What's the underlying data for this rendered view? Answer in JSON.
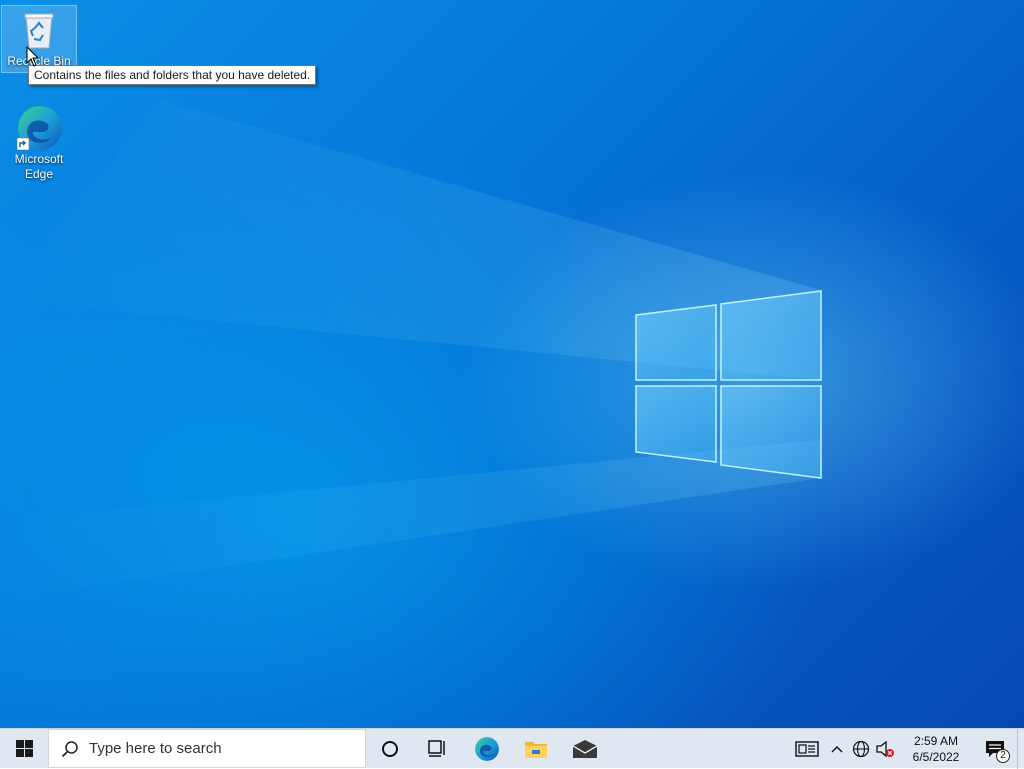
{
  "desktop": {
    "icons": [
      {
        "label": "Recycle Bin",
        "icon": "recycle-bin-icon",
        "selected": true
      },
      {
        "label": "Microsoft Edge",
        "label_lines": [
          "Microsoft",
          "Edge"
        ],
        "icon": "edge-icon",
        "shortcut": true
      }
    ],
    "tooltip": "Contains the files and folders that you have deleted."
  },
  "taskbar": {
    "start_icon": "windows-logo-icon",
    "search": {
      "placeholder": "Type here to search",
      "icon": "search-icon"
    },
    "cortana_icon": "cortana-circle-icon",
    "task_view_icon": "task-view-icon",
    "pinned_apps": [
      {
        "name": "Microsoft Edge",
        "icon": "edge-icon"
      },
      {
        "name": "File Explorer",
        "icon": "file-explorer-icon"
      },
      {
        "name": "Mail",
        "icon": "mail-icon"
      }
    ],
    "tray": {
      "icons": [
        "news-icon",
        "chevron-up-icon",
        "network-icon",
        "volume-muted-icon"
      ],
      "time": "2:59 AM",
      "date": "6/5/2022",
      "notification_count": "2"
    }
  },
  "colors": {
    "desktop_blue": "#0679da",
    "taskbar": "#dfe7f1",
    "window_glow": "#a8ecff"
  }
}
